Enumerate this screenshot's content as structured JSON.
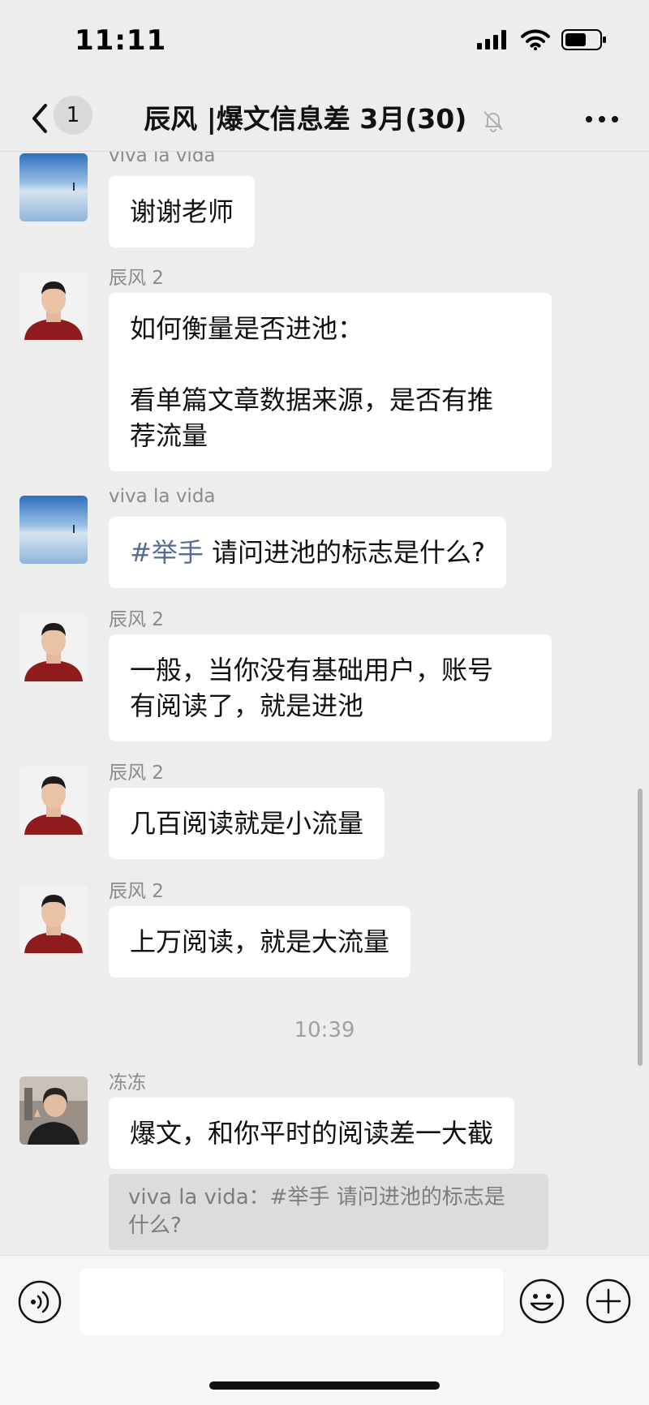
{
  "status": {
    "time": "11:11"
  },
  "header": {
    "unread_count": "1",
    "title": "辰风 |爆文信息差 3月(30)"
  },
  "messages": [
    {
      "sender": "viva la vida",
      "avatar": "landscape-avatar",
      "text": "谢谢老师"
    },
    {
      "sender": "辰风 2",
      "avatar": "man-red-sweater-avatar",
      "lines": [
        "如何衡量是否进池：",
        "",
        "看单篇文章数据来源，是否有推",
        "荐流量"
      ]
    },
    {
      "sender": "viva la vida",
      "avatar": "landscape-avatar",
      "tag": "#举手",
      "text": " 请问进池的标志是什么?"
    },
    {
      "sender": "辰风 2",
      "avatar": "man-red-sweater-avatar",
      "lines": [
        "一般，当你没有基础用户，账号",
        "有阅读了，就是进池"
      ]
    },
    {
      "sender": "辰风 2",
      "avatar": "man-red-sweater-avatar",
      "text": "几百阅读就是小流量"
    },
    {
      "sender": "辰风 2",
      "avatar": "man-red-sweater-avatar",
      "text": "上万阅读，就是大流量"
    },
    {
      "sender": "冻冻",
      "avatar": "woman-photo-avatar",
      "text": "爆文，和你平时的阅读差一大截",
      "quote_lines": [
        "viva la vida：#举手 请问进池的标志是",
        "什么?"
      ]
    }
  ],
  "timestamp": "10:39",
  "input": {
    "value": ""
  },
  "colors": {
    "background": "#ededed",
    "bubble": "#ffffff",
    "tag": "#576b95"
  }
}
